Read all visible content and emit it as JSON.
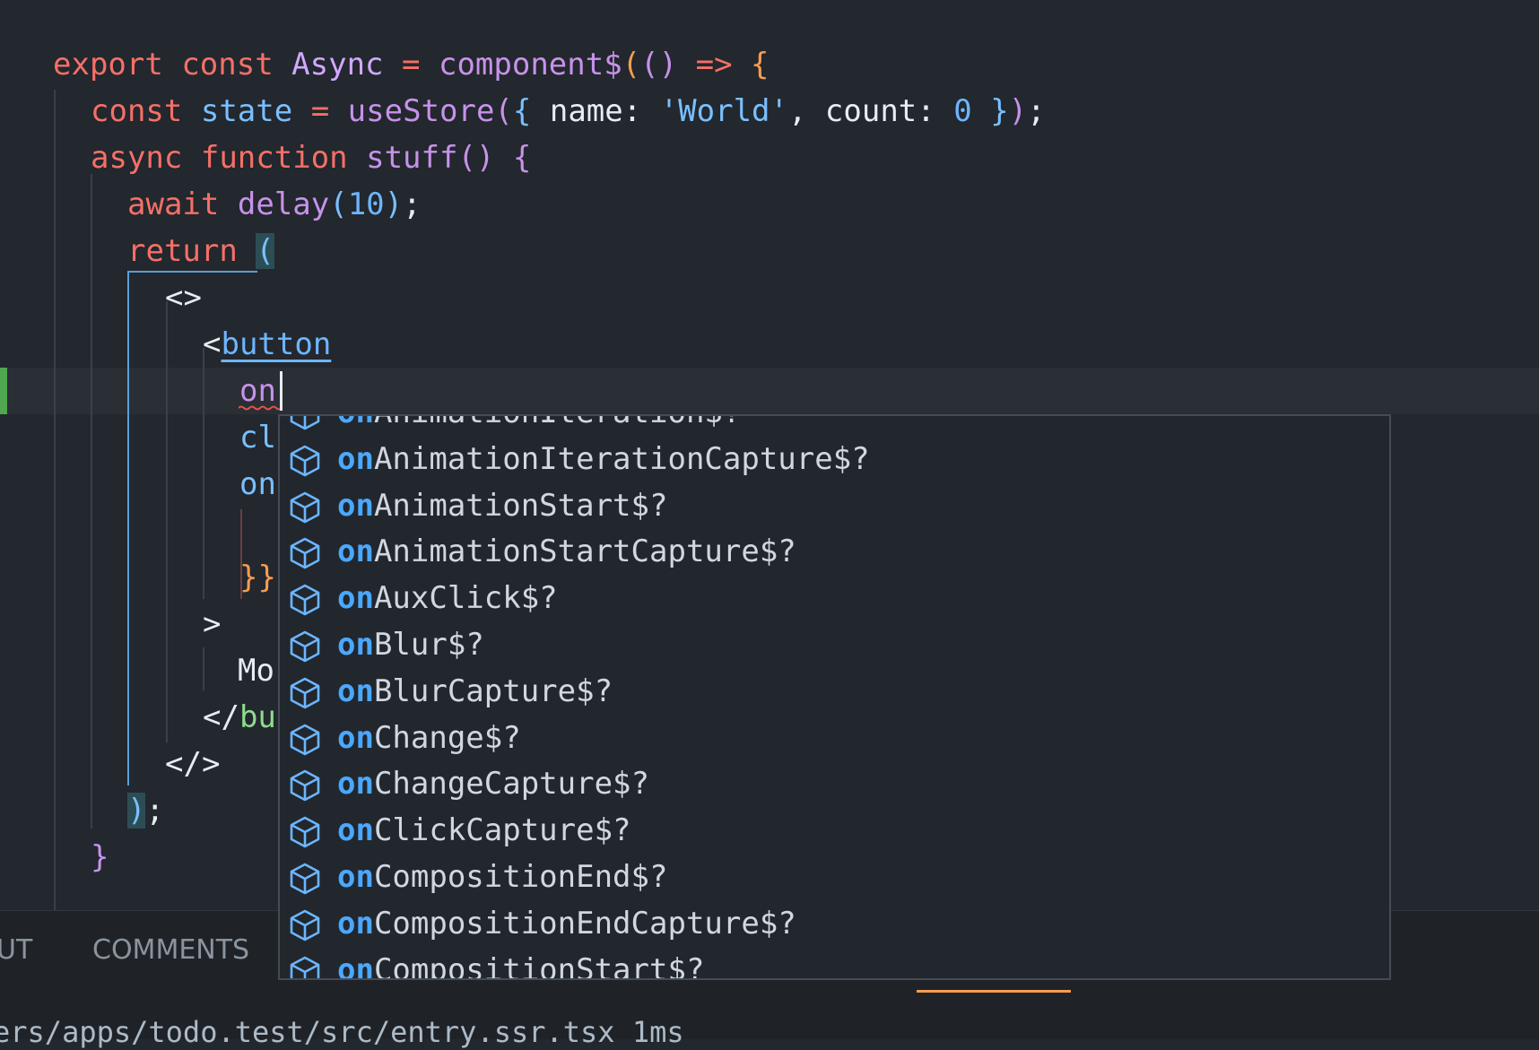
{
  "editor": {
    "lines": [
      {
        "id": "l1",
        "parts": [
          [
            "kw",
            "export"
          ],
          [
            "plain",
            " "
          ],
          [
            "kw",
            "const"
          ],
          [
            "plain",
            " "
          ],
          [
            "cls",
            "Async"
          ],
          [
            "plain",
            " "
          ],
          [
            "kw",
            "="
          ],
          [
            "plain",
            " "
          ],
          [
            "fn",
            "component$"
          ],
          [
            "br1",
            "("
          ],
          [
            "br2",
            "()"
          ],
          [
            "plain",
            " "
          ],
          [
            "kw",
            "=>"
          ],
          [
            "plain",
            " "
          ],
          [
            "br1",
            "{"
          ]
        ]
      },
      {
        "id": "l2",
        "parts": [
          [
            "kw",
            "const"
          ],
          [
            "plain",
            " "
          ],
          [
            "var",
            "state"
          ],
          [
            "plain",
            " "
          ],
          [
            "kw",
            "="
          ],
          [
            "plain",
            " "
          ],
          [
            "fn",
            "useStore"
          ],
          [
            "br2",
            "("
          ],
          [
            "br3",
            "{"
          ],
          [
            "plain",
            " name: "
          ],
          [
            "str",
            "'World'"
          ],
          [
            "plain",
            ", count: "
          ],
          [
            "num",
            "0"
          ],
          [
            "plain",
            " "
          ],
          [
            "br3",
            "}"
          ],
          [
            "br2",
            ")"
          ],
          [
            "plain",
            ";"
          ]
        ]
      },
      {
        "id": "l3",
        "parts": [
          [
            "kw",
            "async"
          ],
          [
            "plain",
            " "
          ],
          [
            "kw",
            "function"
          ],
          [
            "plain",
            " "
          ],
          [
            "fn",
            "stuff"
          ],
          [
            "br2",
            "()"
          ],
          [
            "plain",
            " "
          ],
          [
            "br2",
            "{"
          ]
        ]
      },
      {
        "id": "l4",
        "parts": [
          [
            "kw",
            "await"
          ],
          [
            "plain",
            " "
          ],
          [
            "fn",
            "delay"
          ],
          [
            "br3",
            "("
          ],
          [
            "num",
            "10"
          ],
          [
            "br3",
            ")"
          ],
          [
            "plain",
            ";"
          ]
        ]
      },
      {
        "id": "l5",
        "parts": [
          [
            "kw",
            "return"
          ],
          [
            "plain",
            " "
          ],
          [
            "hl br3",
            "("
          ]
        ]
      },
      {
        "id": "l6",
        "parts": [
          [
            "plain",
            "<>"
          ]
        ]
      },
      {
        "id": "l7",
        "parts": [
          [
            "plain",
            "<"
          ],
          [
            "tagname",
            "button"
          ]
        ]
      },
      {
        "id": "l8",
        "parts": [
          [
            "attr",
            "on"
          ]
        ]
      },
      {
        "id": "l9",
        "parts": [
          [
            "var",
            "cl"
          ]
        ]
      },
      {
        "id": "l10",
        "parts": [
          [
            "var",
            "on"
          ]
        ]
      },
      {
        "id": "l11",
        "parts": [
          [
            "br1",
            "}}"
          ]
        ]
      },
      {
        "id": "l12",
        "parts": [
          [
            "plain",
            ">"
          ]
        ]
      },
      {
        "id": "l13",
        "parts": [
          [
            "plain",
            "Mo"
          ]
        ]
      },
      {
        "id": "l14",
        "parts": [
          [
            "plain",
            "</"
          ],
          [
            "tagname2",
            "bu"
          ]
        ]
      },
      {
        "id": "l15",
        "parts": [
          [
            "plain",
            "</>"
          ]
        ]
      },
      {
        "id": "l16",
        "parts": [
          [
            "hl br3",
            ")"
          ],
          [
            "plain",
            ";"
          ]
        ]
      },
      {
        "id": "l17",
        "parts": [
          [
            "br2",
            "}"
          ]
        ]
      }
    ]
  },
  "suggest": {
    "match": "on",
    "items": [
      "AnimationIteration$?",
      "AnimationIterationCapture$?",
      "AnimationStart$?",
      "AnimationStartCapture$?",
      "AuxClick$?",
      "Blur$?",
      "BlurCapture$?",
      "Change$?",
      "ChangeCapture$?",
      "ClickCapture$?",
      "CompositionEnd$?",
      "CompositionEndCapture$?",
      "CompositionStart$?"
    ],
    "icon": "cube-icon"
  },
  "panel": {
    "tab_output": "UT",
    "tab_comments": "COMMENTS",
    "status_path": "ers/apps/todo.test/src/entry.ssr.tsx",
    "status_time": "1ms"
  }
}
